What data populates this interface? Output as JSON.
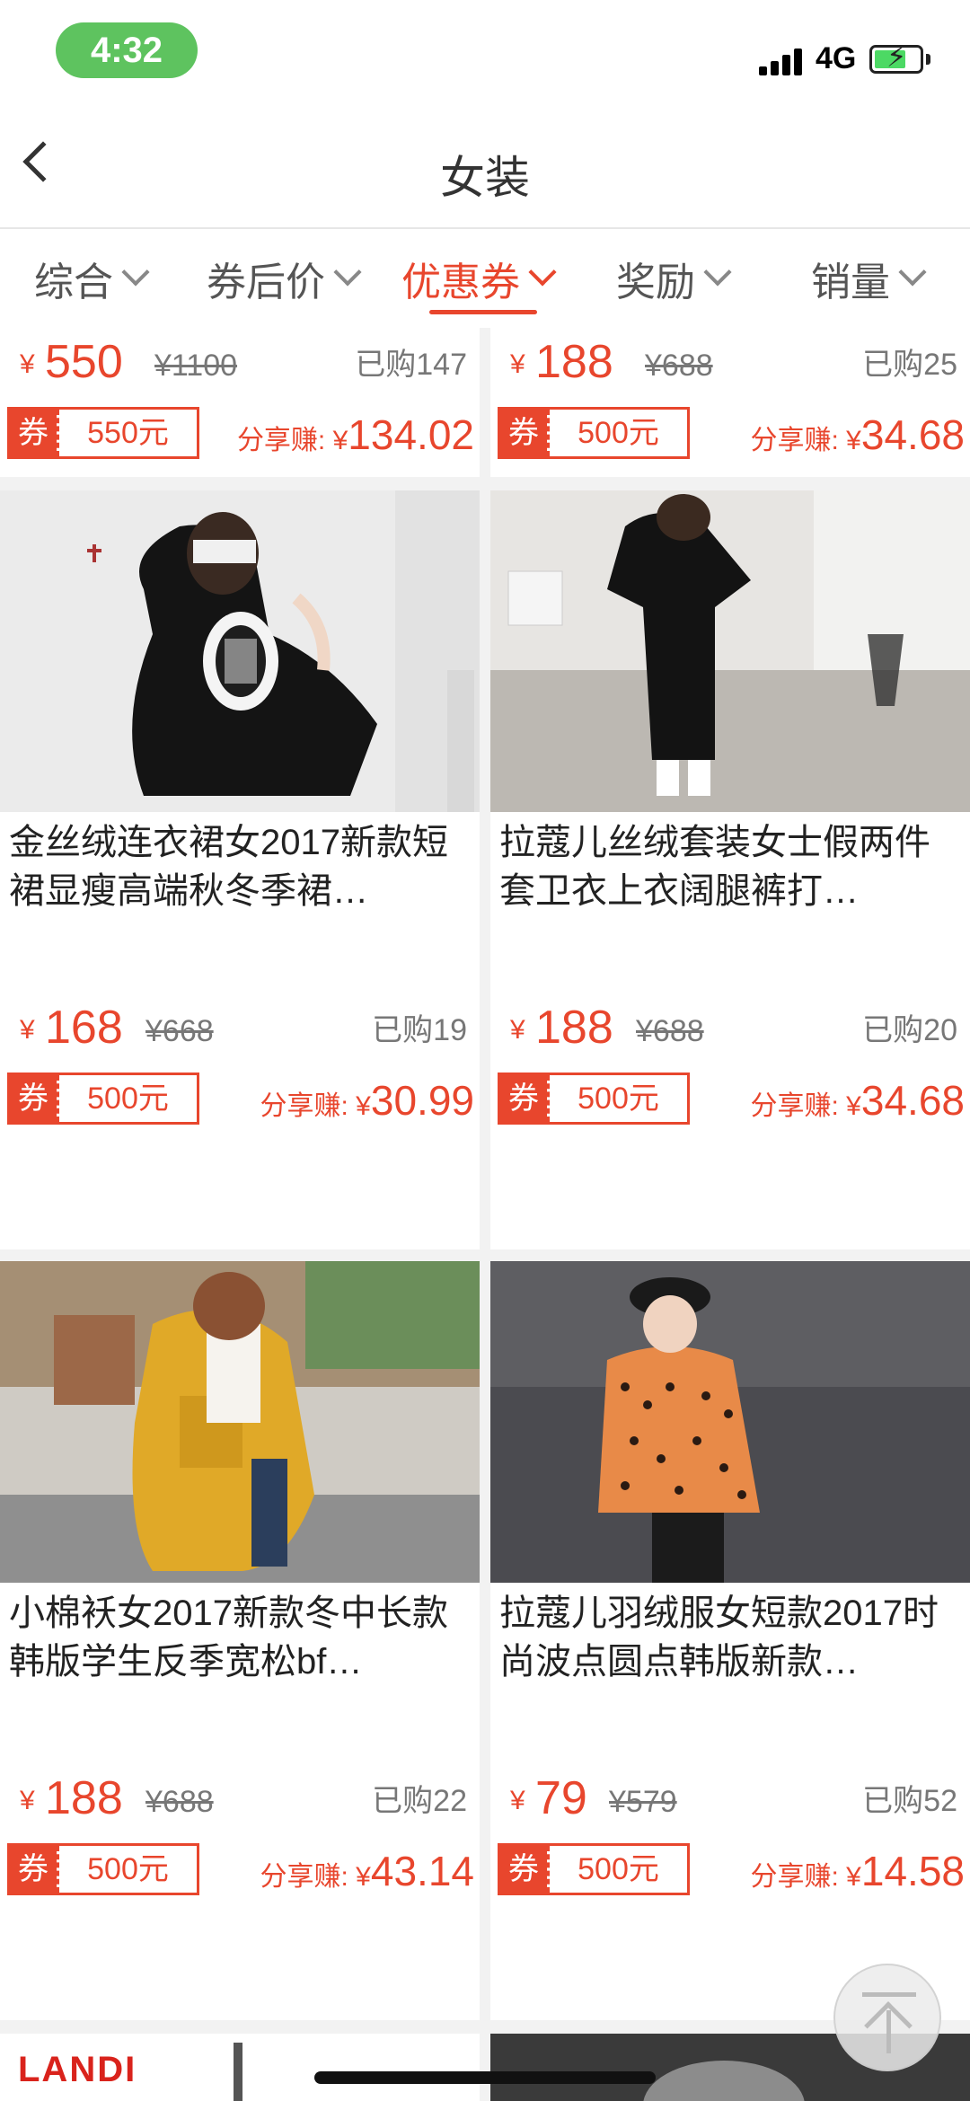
{
  "status": {
    "time": "4:32",
    "network": "4G"
  },
  "nav": {
    "title": "女装"
  },
  "filters": [
    {
      "label": "综合",
      "active": false
    },
    {
      "label": "券后价",
      "active": false
    },
    {
      "label": "优惠券",
      "active": true
    },
    {
      "label": "奖励",
      "active": false
    },
    {
      "label": "销量",
      "active": false
    }
  ],
  "products": [
    {
      "title": "",
      "currency": "¥",
      "price": "550",
      "original": "¥1100",
      "sold": "已购147",
      "coupon_label": "券",
      "coupon": "550元",
      "share_label": "分享赚: ¥",
      "share_amount": "134.02"
    },
    {
      "title": "",
      "currency": "¥",
      "price": "188",
      "original": "¥688",
      "sold": "已购25",
      "coupon_label": "券",
      "coupon": "500元",
      "share_label": "分享赚: ¥",
      "share_amount": "34.68"
    },
    {
      "title": "金丝绒连衣裙女2017新款短裙显瘦高端秋冬季裙…",
      "currency": "¥",
      "price": "168",
      "original": "¥668",
      "sold": "已购19",
      "coupon_label": "券",
      "coupon": "500元",
      "share_label": "分享赚: ¥",
      "share_amount": "30.99"
    },
    {
      "title": "拉蔻儿丝绒套装女士假两件套卫衣上衣阔腿裤打…",
      "currency": "¥",
      "price": "188",
      "original": "¥688",
      "sold": "已购20",
      "coupon_label": "券",
      "coupon": "500元",
      "share_label": "分享赚: ¥",
      "share_amount": "34.68"
    },
    {
      "title": "小棉袄女2017新款冬中长款韩版学生反季宽松bf…",
      "currency": "¥",
      "price": "188",
      "original": "¥688",
      "sold": "已购22",
      "coupon_label": "券",
      "coupon": "500元",
      "share_label": "分享赚: ¥",
      "share_amount": "43.14"
    },
    {
      "title": "拉蔻儿羽绒服女短款2017时尚波点圆点韩版新款…",
      "currency": "¥",
      "price": "79",
      "original": "¥579",
      "sold": "已购52",
      "coupon_label": "券",
      "coupon": "500元",
      "share_label": "分享赚: ¥",
      "share_amount": "14.58"
    }
  ],
  "partial": {
    "brand": "LANDI"
  },
  "colors": {
    "accent": "#e8462d",
    "status_pill": "#5ec35f"
  },
  "icons": [
    "back-arrow-icon",
    "chevron-down-icon",
    "signal-icon",
    "battery-icon",
    "back-to-top-icon"
  ]
}
